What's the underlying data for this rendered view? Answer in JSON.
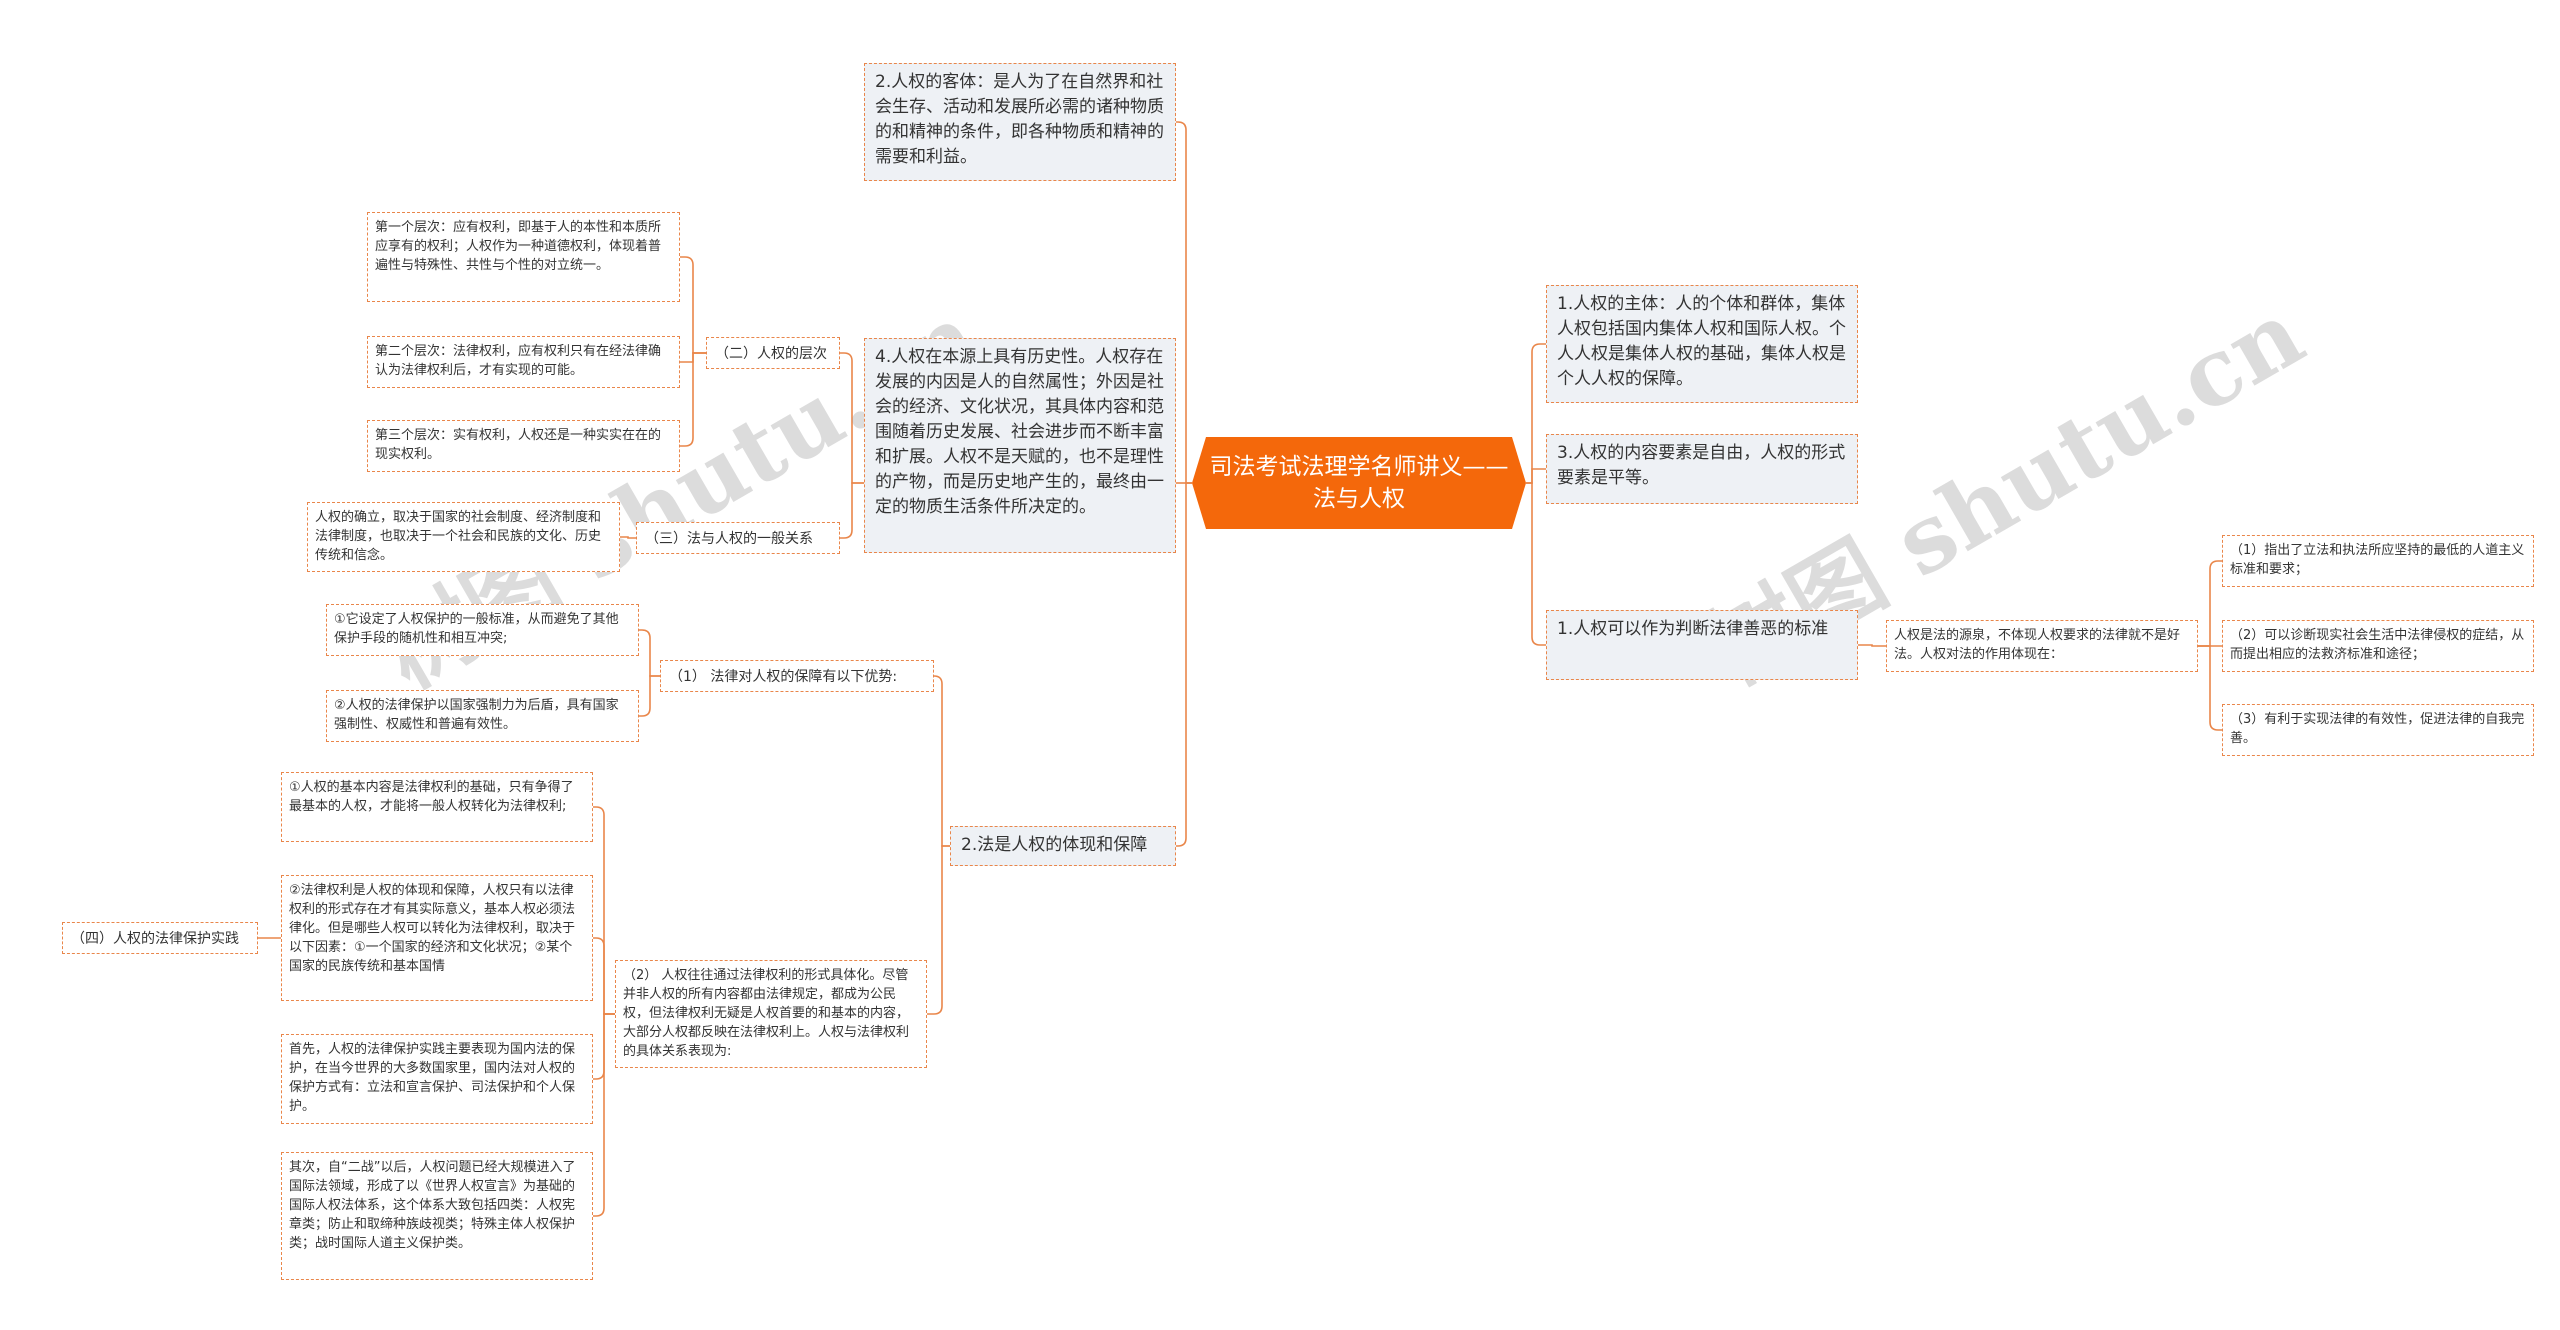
{
  "root": {
    "title": "司法考试法理学名师讲义——法与人权"
  },
  "watermark": {
    "text": "树图 shutu.cn"
  },
  "colors": {
    "accent": "#f4680b",
    "border": "#e9864a",
    "line": "#e9864a",
    "node_fill": "#eef1f5"
  },
  "nodes": {
    "r1": "1.人权的主体：人的个体和群体，集体人权包括国内集体人权和国际人权。个人人权是集体人权的基础，集体人权是个人人权的保障。",
    "r2": "3.人权的内容要素是自由，人权的形式要素是平等。",
    "r3": "1.人权可以作为判断法律善恶的标准",
    "r3a": "人权是法的源泉，不体现人权要求的法律就不是好法。人权对法的作用体现在：",
    "r3a1": "（1）指出了立法和执法所应坚持的最低的人道主义标准和要求；",
    "r3a2": "（2）可以诊断现实社会生活中法律侵权的症结，从而提出相应的法救济标准和途径；",
    "r3a3": "（3）有利于实现法律的有效性，促进法律的自我完善。",
    "l1": "2.人权的客体：是人为了在自然界和社会生存、活动和发展所必需的诸种物质的和精神的条件，即各种物质和精神的需要和利益。",
    "l2": "4.人权在本源上具有历史性。人权存在发展的内因是人的自然属性；外因是社会的经济、文化状况，其具体内容和范围随着历史发展、社会进步而不断丰富和扩展。人权不是天赋的，也不是理性的产物，而是历史地产生的，最终由一定的物质生活条件所决定的。",
    "l2a": "（二）人权的层次",
    "l2a1": "第一个层次：应有权利，即基于人的本性和本质所应享有的权利；人权作为一种道德权利，体现着普遍性与特殊性、共性与个性的对立统一。",
    "l2a2": "第二个层次：法律权利，应有权利只有在经法律确认为法律权利后，才有实现的可能。",
    "l2a3": "第三个层次：实有权利，人权还是一种实实在在的现实权利。",
    "l2b": "（三）法与人权的一般关系",
    "l2b1": "人权的确立，取决于国家的社会制度、经济制度和法律制度，也取决于一个社会和民族的文化、历史传统和信念。",
    "l3": "2.法是人权的体现和保障",
    "l3a": "（1） 法律对人权的保障有以下优势:",
    "l3a1": "①它设定了人权保护的一般标准，从而避免了其他保护手段的随机性和相互冲突;",
    "l3a2": "②人权的法律保护以国家强制力为后盾，具有国家强制性、权威性和普遍有效性。",
    "l3b": "（2） 人权往往通过法律权利的形式具体化。尽管并非人权的所有内容都由法律规定，都成为公民权，但法律权利无疑是人权首要的和基本的内容，大部分人权都反映在法律权利上。人权与法律权利的具体关系表现为:",
    "l3b1": "①人权的基本内容是法律权利的基础，只有争得了最基本的人权，才能将一般人权转化为法律权利;",
    "l3b2": "②法律权利是人权的体现和保障，人权只有以法律权利的形式存在才有其实际意义，基本人权必须法律化。但是哪些人权可以转化为法律权利，取决于以下因素：①一个国家的经济和文化状况；②某个国家的民族传统和基本国情",
    "l3b3": "首先，人权的法律保护实践主要表现为国内法的保护，在当今世界的大多数国家里，国内法对人权的保护方式有：立法和宣言保护、司法保护和个人保护。",
    "l3b4": "其次，自“二战”以后，人权问题已经大规模进入了国际法领域，形成了以《世界人权宣言》为基础的国际人权法体系，这个体系大致包括四类：人权宪章类；防止和取缔种族歧视类；特殊主体人权保护类；战时国际人道主义保护类。",
    "l3b2x": "（四）人权的法律保护实践"
  }
}
